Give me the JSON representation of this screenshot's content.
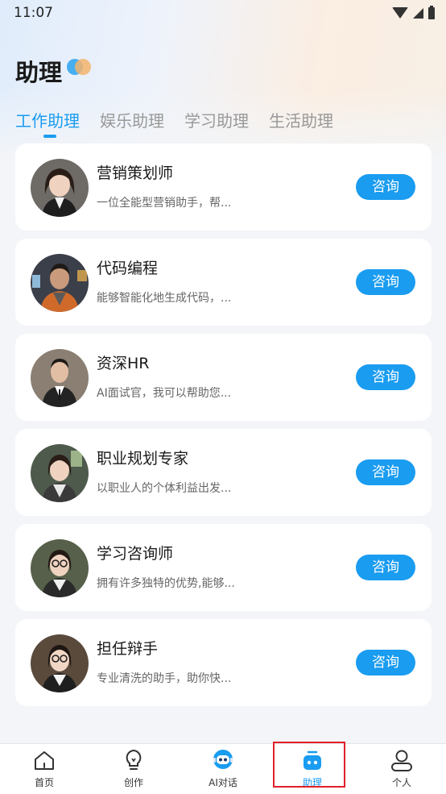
{
  "status_bar": {
    "time": "11:07"
  },
  "header": {
    "title": "助理"
  },
  "tabs": [
    {
      "label": "工作助理",
      "active": true
    },
    {
      "label": "娱乐助理",
      "active": false
    },
    {
      "label": "学习助理",
      "active": false
    },
    {
      "label": "生活助理",
      "active": false
    }
  ],
  "assistants": [
    {
      "name": "营销策划师",
      "desc": "一位全能型营销助手，帮...",
      "button": "咨询",
      "avatar": "businesswoman-avatar"
    },
    {
      "name": "代码编程",
      "desc": "能够智能化地生成代码，...",
      "button": "咨询",
      "avatar": "programmer-avatar"
    },
    {
      "name": "资深HR",
      "desc": "AI面试官，我可以帮助您...",
      "button": "咨询",
      "avatar": "hr-man-avatar"
    },
    {
      "name": "职业规划专家",
      "desc": "以职业人的个体利益出发...",
      "button": "咨询",
      "avatar": "career-woman-avatar"
    },
    {
      "name": "学习咨询师",
      "desc": "拥有许多独特的优势,能够...",
      "button": "咨询",
      "avatar": "study-consultant-avatar"
    },
    {
      "name": "担任辩手",
      "desc": "专业清洗的助手，助你快...",
      "button": "咨询",
      "avatar": "debater-avatar"
    }
  ],
  "bottom_nav": [
    {
      "label": "首页",
      "icon": "home-icon"
    },
    {
      "label": "创作",
      "icon": "lightbulb-icon"
    },
    {
      "label": "AI对话",
      "icon": "robot-icon"
    },
    {
      "label": "助理",
      "icon": "assistant-icon",
      "active": true
    },
    {
      "label": "个人",
      "icon": "person-icon"
    }
  ],
  "colors": {
    "accent": "#1a9cf0",
    "highlight": "#e0202a"
  }
}
